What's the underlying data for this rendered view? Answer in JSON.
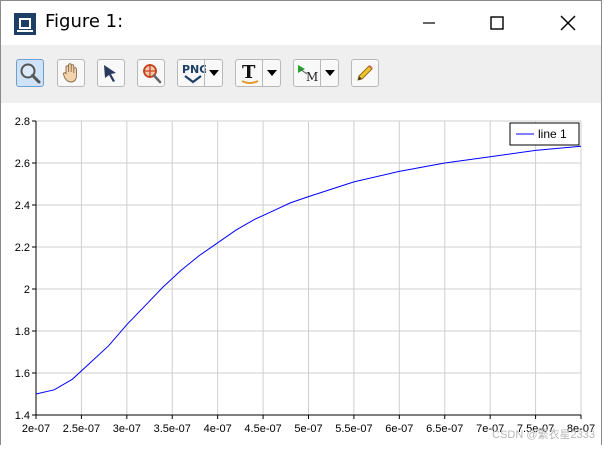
{
  "window": {
    "title": "Figure 1:"
  },
  "toolbar": {
    "buttons": [
      {
        "name": "zoom",
        "icon": "magnifier-icon"
      },
      {
        "name": "pan",
        "icon": "hand-icon"
      },
      {
        "name": "select",
        "icon": "arrow-cursor-icon"
      },
      {
        "name": "zoom-region",
        "icon": "zoom-target-icon"
      },
      {
        "name": "save-png",
        "icon": "png-icon",
        "label": "PNG"
      },
      {
        "name": "text",
        "icon": "text-icon",
        "label": "T"
      },
      {
        "name": "marker",
        "icon": "marker-icon",
        "label": "M"
      },
      {
        "name": "edit",
        "icon": "pencil-icon"
      }
    ]
  },
  "watermark": "CSDN @繁衣星2333",
  "chart_data": {
    "type": "line",
    "title": "",
    "xlabel": "",
    "ylabel": "",
    "xlim": [
      2e-07,
      8e-07
    ],
    "ylim": [
      1.4,
      2.8
    ],
    "xticks": [
      "2e-07",
      "2.5e-07",
      "3e-07",
      "3.5e-07",
      "4e-07",
      "4.5e-07",
      "5e-07",
      "5.5e-07",
      "6e-07",
      "6.5e-07",
      "7e-07",
      "7.5e-07",
      "8e-07"
    ],
    "yticks": [
      "1.4",
      "1.6",
      "1.8",
      "2",
      "2.2",
      "2.4",
      "2.6",
      "2.8"
    ],
    "grid": true,
    "legend": "top-right",
    "series": [
      {
        "name": "line 1",
        "color": "#0000ff",
        "x": [
          2e-07,
          2.2e-07,
          2.4e-07,
          2.6e-07,
          2.8e-07,
          3e-07,
          3.2e-07,
          3.4e-07,
          3.6e-07,
          3.8e-07,
          4e-07,
          4.2e-07,
          4.4e-07,
          4.6e-07,
          4.8e-07,
          5e-07,
          5.5e-07,
          6e-07,
          6.5e-07,
          7e-07,
          7.5e-07,
          8e-07
        ],
        "y": [
          1.5,
          1.52,
          1.57,
          1.65,
          1.73,
          1.83,
          1.92,
          2.01,
          2.09,
          2.16,
          2.22,
          2.28,
          2.33,
          2.37,
          2.41,
          2.44,
          2.51,
          2.56,
          2.6,
          2.63,
          2.66,
          2.68
        ]
      }
    ]
  }
}
